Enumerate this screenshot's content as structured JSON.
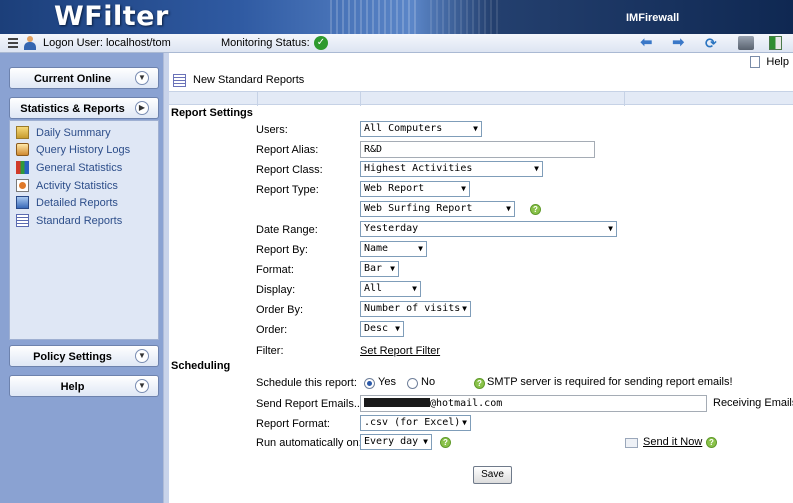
{
  "header": {
    "logo": "WFilter",
    "product": "IMFirewall"
  },
  "toolbar": {
    "logon_label": "Logon User: localhost/tom",
    "monitoring_label": "Monitoring Status:"
  },
  "sidebar": {
    "panels": [
      {
        "label": "Current Online"
      },
      {
        "label": "Statistics & Reports"
      },
      {
        "label": "Policy Settings"
      },
      {
        "label": "Help"
      }
    ],
    "items": [
      {
        "label": "Daily Summary",
        "icon": "daily-summary-icon"
      },
      {
        "label": "Query History Logs",
        "icon": "query-history-icon"
      },
      {
        "label": "General Statistics",
        "icon": "general-statistics-icon"
      },
      {
        "label": "Activity Statistics",
        "icon": "activity-statistics-icon"
      },
      {
        "label": "Detailed Reports",
        "icon": "detailed-reports-icon"
      },
      {
        "label": "Standard Reports",
        "icon": "standard-reports-icon"
      }
    ]
  },
  "main": {
    "help_label": "Help",
    "title": "New Standard Reports",
    "sections": {
      "report_settings": "Report Settings",
      "scheduling": "Scheduling"
    },
    "form": {
      "users": {
        "label": "Users:",
        "value": "All Computers"
      },
      "alias": {
        "label": "Report Alias:",
        "value": "R&D"
      },
      "class": {
        "label": "Report Class:",
        "value": "Highest Activities"
      },
      "type": {
        "label": "Report Type:",
        "value": "Web Report",
        "sub_value": "Web Surfing Report"
      },
      "date_range": {
        "label": "Date Range:",
        "value": "Yesterday"
      },
      "report_by": {
        "label": "Report By:",
        "value": "Name"
      },
      "format": {
        "label": "Format:",
        "value": "Bar"
      },
      "display": {
        "label": "Display:",
        "value": "All"
      },
      "order_by": {
        "label": "Order By:",
        "value": "Number of visits"
      },
      "order": {
        "label": "Order:",
        "value": "Desc"
      },
      "filter": {
        "label": "Filter:",
        "link": "Set Report Filter"
      }
    },
    "scheduling": {
      "schedule": {
        "label": "Schedule this report:",
        "yes": "Yes",
        "no": "No",
        "selected": "Yes",
        "smtp_note": "SMTP server is required for sending report emails!"
      },
      "emails": {
        "label": "Send Report Emails...",
        "value_suffix": "@hotmail.com",
        "side_label": "Receiving Emails"
      },
      "report_format": {
        "label": "Report Format:",
        "value": ".csv (for Excel)"
      },
      "run": {
        "label": "Run automatically on:",
        "value": "Every day",
        "send_link": "Send it Now"
      }
    },
    "save_label": "Save"
  }
}
